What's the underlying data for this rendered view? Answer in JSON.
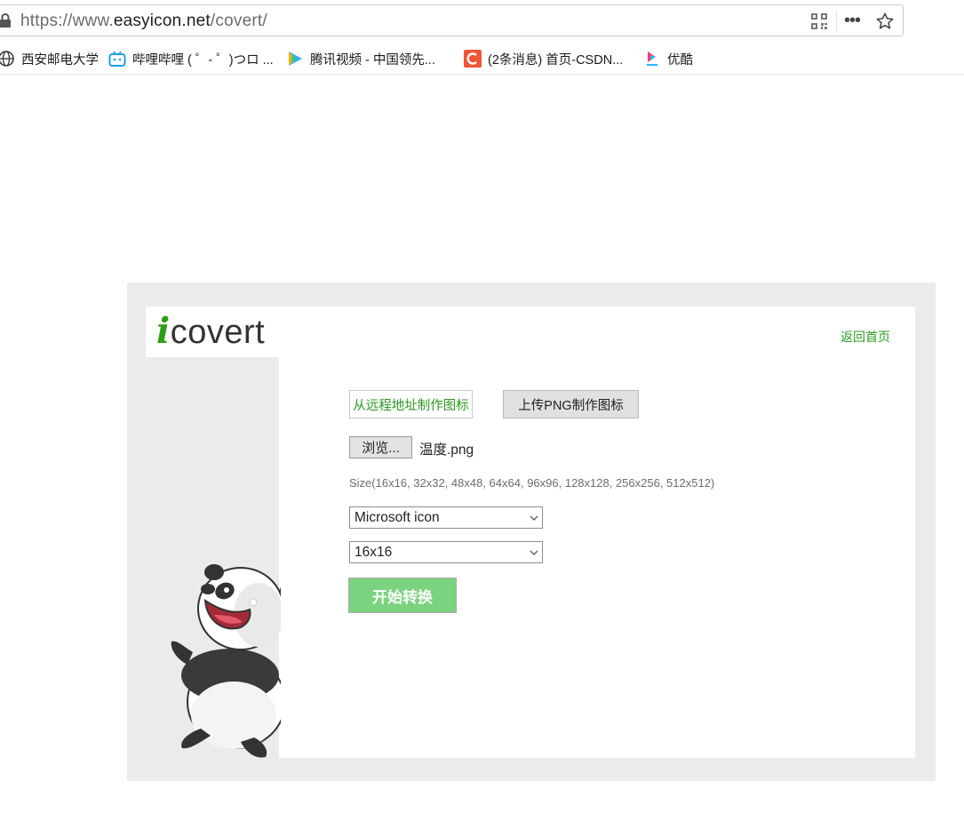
{
  "browser": {
    "url_prefix": "https://www.",
    "url_domain": "easyicon.net",
    "url_path": "/covert/",
    "menu_label": "•••",
    "bookmarks": [
      {
        "label": "西安邮电大学",
        "icon": "globe-icon"
      },
      {
        "label": "哔哩哔哩 ( ゜- ゜)つロ ...",
        "icon": "bilibili-icon"
      },
      {
        "label": "腾讯视频 - 中国领先...",
        "icon": "tencent-video-icon"
      },
      {
        "label": "(2条消息) 首页-CSDN...",
        "icon": "csdn-icon"
      },
      {
        "label": "优酷",
        "icon": "youku-icon"
      }
    ]
  },
  "page": {
    "logo_i": "i",
    "logo_text": "covert",
    "home_link": "返回首页",
    "tabs": {
      "remote": "从远程地址制作图标",
      "upload": "上传PNG制作图标"
    },
    "browse_label": "浏览...",
    "file_name": "温度.png",
    "size_hint": "Size(16x16, 32x32, 48x48, 64x64, 96x96, 128x128, 256x256, 512x512)",
    "format_select": {
      "selected": "Microsoft icon"
    },
    "size_select": {
      "selected": "16x16"
    },
    "convert_label": "开始转换"
  },
  "colors": {
    "accent": "#2b9a1f",
    "convert_button": "#7bd37f",
    "frame": "#ebebeb"
  }
}
